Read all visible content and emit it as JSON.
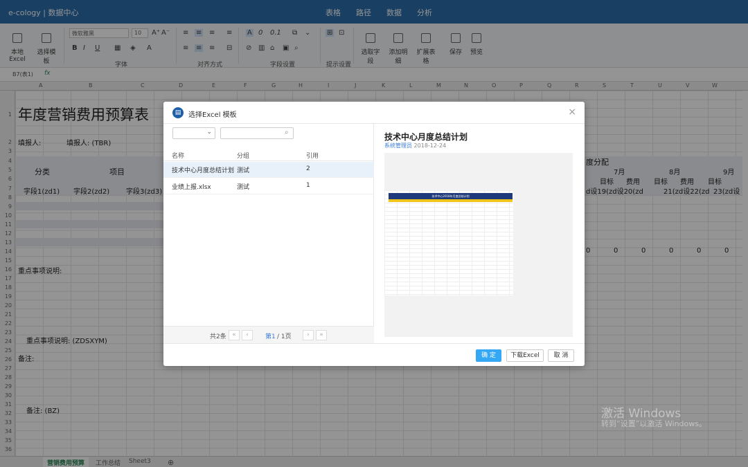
{
  "app": {
    "brand": "e-cology | 数据中心",
    "nav": [
      "表格",
      "路径",
      "数据",
      "分析"
    ]
  },
  "ribbon": {
    "local_excel": "本地Excel",
    "select_template": "选择模板",
    "font_name": "微软雅黑",
    "font_size": "10",
    "font_group": "字体",
    "align_group": "对齐方式",
    "field_group": "字段设置",
    "display_group": "提示设置",
    "select_field": "选取字段",
    "add_desc": "添加明细",
    "expand_table": "扩展表格",
    "save": "保存",
    "preview": "预览"
  },
  "formula": {
    "cell_ref": "B7(表1)",
    "fx": "fx"
  },
  "sheet": {
    "title": "年度营销费用预算表",
    "fill_label": "填报人:",
    "fill_value": "填报人: (TBR)",
    "cat_label": "分类",
    "item_label": "项目",
    "field1": "字段1(zd1)",
    "field2": "字段2(zd2)",
    "field3": "字段3(zd3)",
    "quarter_title": "度分配",
    "month7": "7月",
    "month8": "8月",
    "month9": "9月",
    "target": "目标",
    "cost": "费用",
    "tail7": "d设19(zd设20(zd",
    "tail8": "21(zd设22(zd",
    "tail9": "23(zd设",
    "zeros": [
      "0",
      "0",
      "0",
      "0",
      "0",
      "0"
    ],
    "key_note": "重点事项说明:",
    "key_note_field": "重点事项说明: (ZDSXYM)",
    "remark": "备注:",
    "remark_field": "备注: (BZ)"
  },
  "tabs": [
    "营销费用预算",
    "工作总结",
    "Sheet3"
  ],
  "watermark": {
    "line1": "激活 Windows",
    "line2": "转到“设置”以激活 Windows。"
  },
  "modal": {
    "title": "选择Excel 模板",
    "columns": [
      "名称",
      "分组",
      "引用"
    ],
    "rows": [
      {
        "name": "技术中心月度总结计划",
        "group": "测试",
        "ref": "2"
      },
      {
        "name": "业绩上报.xlsx",
        "group": "测试",
        "ref": "1"
      }
    ],
    "total": "共2条",
    "page": "第1",
    "pages": "/ 1页",
    "preview_title": "技术中心月度总结计划",
    "preview_author": "系统管理员",
    "preview_date": "2018-12-24",
    "preview_banner": "技术中心2018年月度总结计划",
    "btn_ok": "确 定",
    "btn_download": "下载Excel",
    "btn_cancel": "取 消"
  },
  "colors": {
    "topbar": "#2c6dab",
    "primary": "#35a8f5",
    "active_tab": "#2e8b57"
  }
}
